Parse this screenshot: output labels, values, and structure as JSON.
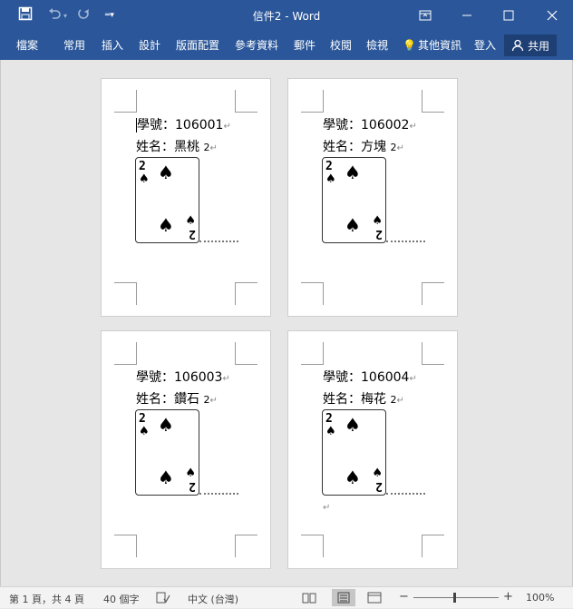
{
  "titlebar": {
    "title": "信件2 - Word",
    "undo_icon": "undo-arrow",
    "redo_icon": "redo-circle",
    "save_icon": "floppy-disk"
  },
  "ribbon": {
    "tabs": [
      "檔案",
      "常用",
      "插入",
      "設計",
      "版面配置",
      "參考資料",
      "郵件",
      "校閱",
      "檢視"
    ],
    "tell_me": "其他資訊",
    "signin": "登入",
    "share": "共用"
  },
  "pages": [
    {
      "id_line": "學號：106001",
      "name_line": "姓名：黑桃",
      "card_rank": "2",
      "card_suffix": "2",
      "suit": "♠"
    },
    {
      "id_line": "學號：106002",
      "name_line": "姓名：方塊",
      "card_rank": "2",
      "card_suffix": "2",
      "suit": "♠"
    },
    {
      "id_line": "學號：106003",
      "name_line": "姓名：鑽石",
      "card_rank": "2",
      "card_suffix": "2",
      "suit": "♠"
    },
    {
      "id_line": "學號：106004",
      "name_line": "姓名：梅花",
      "card_rank": "2",
      "card_suffix": "2",
      "suit": "♠"
    }
  ],
  "marks": {
    "return": "↵"
  },
  "status": {
    "page": "第 1 頁，共 4 頁",
    "words": "40 個字",
    "language": "中文 (台灣)",
    "zoom": "100%",
    "zoom_minus": "−",
    "zoom_plus": "+"
  }
}
